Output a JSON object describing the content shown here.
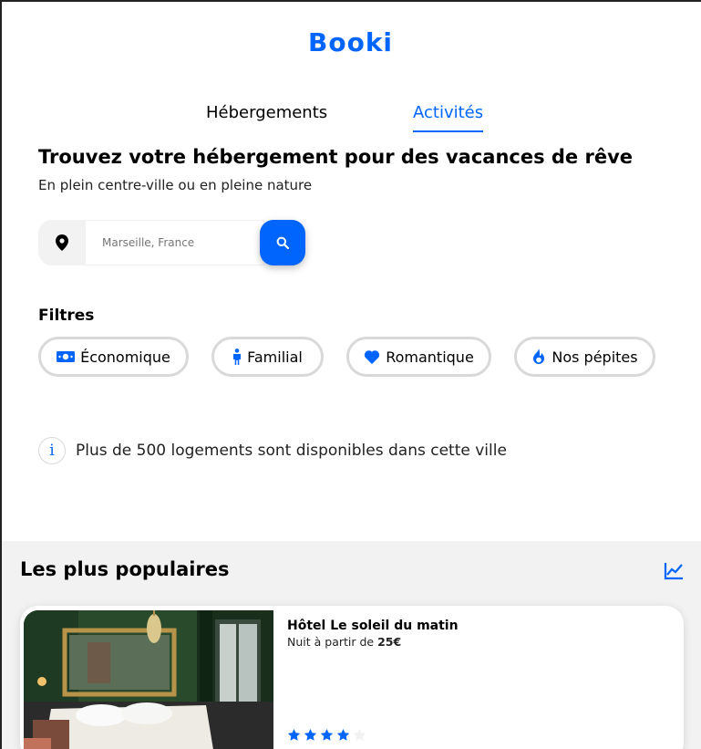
{
  "brand": {
    "logo": "Booki",
    "accent": "#0065FC"
  },
  "tabs": [
    {
      "label": "Hébergements",
      "active": false
    },
    {
      "label": "Activités",
      "active": true
    }
  ],
  "hero": {
    "title": "Trouvez votre hébergement pour des vacances de rêve",
    "subtitle": "En plein centre-ville ou en pleine nature"
  },
  "search": {
    "placeholder": "Marseille, France",
    "pin_icon": "location-pin-icon",
    "button_icon": "search-icon"
  },
  "filters": {
    "title": "Filtres",
    "items": [
      {
        "label": "Économique",
        "icon": "money-icon"
      },
      {
        "label": "Familial",
        "icon": "person-icon"
      },
      {
        "label": "Romantique",
        "icon": "heart-icon"
      },
      {
        "label": "Nos pépites",
        "icon": "fire-icon"
      }
    ]
  },
  "info": {
    "icon": "info-icon",
    "glyph": "i",
    "text": "Plus de 500 logements sont disponibles dans cette ville"
  },
  "popular": {
    "title": "Les plus populaires",
    "trend_icon": "trend-chart-icon",
    "cards": [
      {
        "name": "Hôtel Le soleil du matin",
        "price_prefix": "Nuit à partir de ",
        "price_value": "25€",
        "rating": 4,
        "rating_max": 5
      }
    ]
  }
}
